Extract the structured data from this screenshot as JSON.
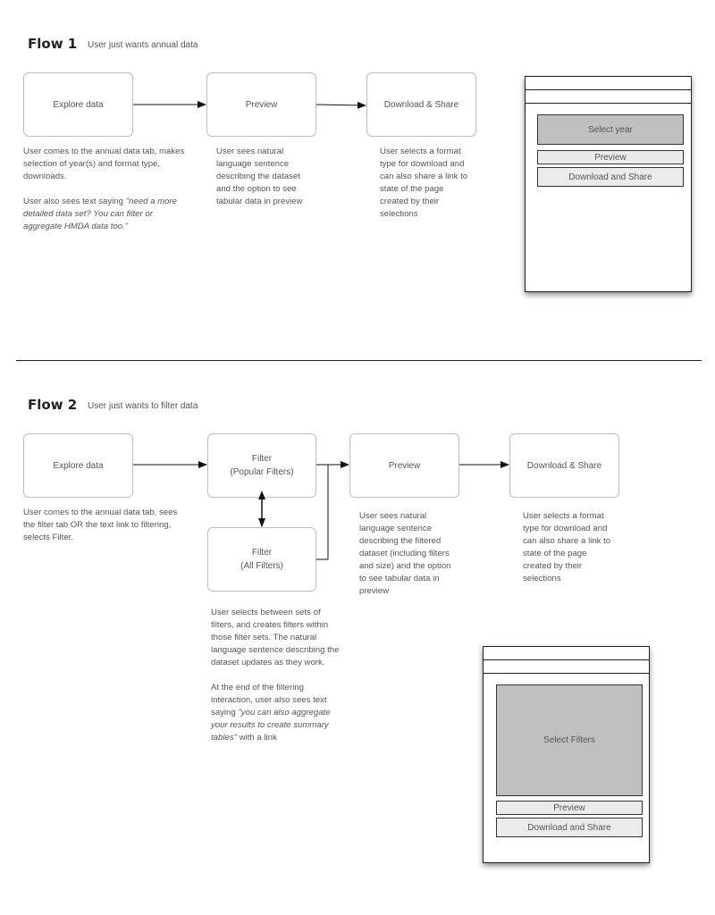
{
  "flow1": {
    "title": "Flow 1",
    "subtitle": "User just wants annual data",
    "nodes": [
      {
        "label": "Explore data"
      },
      {
        "label": "Preview"
      },
      {
        "label": "Download & Share"
      }
    ],
    "descriptions": {
      "explore_p1": "User comes to the annual data tab, makes selection of year(s) and format type, downloads.",
      "explore_p2_prefix": "User also sees text saying ",
      "explore_p2_quote": "\"need a more detailed data set? You can filter or aggregate HMDA data too.\"",
      "preview": "User sees natural language sentence describing the dataset and the option to see tabular data in preview",
      "download": "User selects a format type for download and can also share a link to state of the page created by their selections"
    },
    "wireframe": {
      "select_label": "Select year",
      "preview_label": "Preview",
      "download_label": "Download and Share"
    }
  },
  "flow2": {
    "title": "Flow 2",
    "subtitle": "User just wants to filter data",
    "nodes": [
      {
        "label": "Explore data"
      },
      {
        "label": "Filter\n(Popular Filters)"
      },
      {
        "label": "Filter\n(All Filters)"
      },
      {
        "label": "Preview"
      },
      {
        "label": "Download & Share"
      }
    ],
    "descriptions": {
      "explore": "User comes to the annual data tab, sees the filter tab OR the text link to filtering, selects Filter.",
      "filter_p1": "User selects between sets of filters, and creates filters within those filter sets. The natural language sentence describing the dataset updates as they work.",
      "filter_p2_prefix": "At the end of the filtering interaction, user also sees text saying ",
      "filter_p2_quote": "\"you can also aggregate your results to create summary tables\"",
      "filter_p2_suffix": " with a link",
      "preview": "User sees natural language sentence describing the filtered dataset (including filters and size) and the option to see tabular data in preview",
      "download": "User selects a format type for download and can also share a link to state of the page created by their selections"
    },
    "wireframe": {
      "select_label": "Select Filters",
      "preview_label": "Preview",
      "download_label": "Download and Share"
    }
  }
}
